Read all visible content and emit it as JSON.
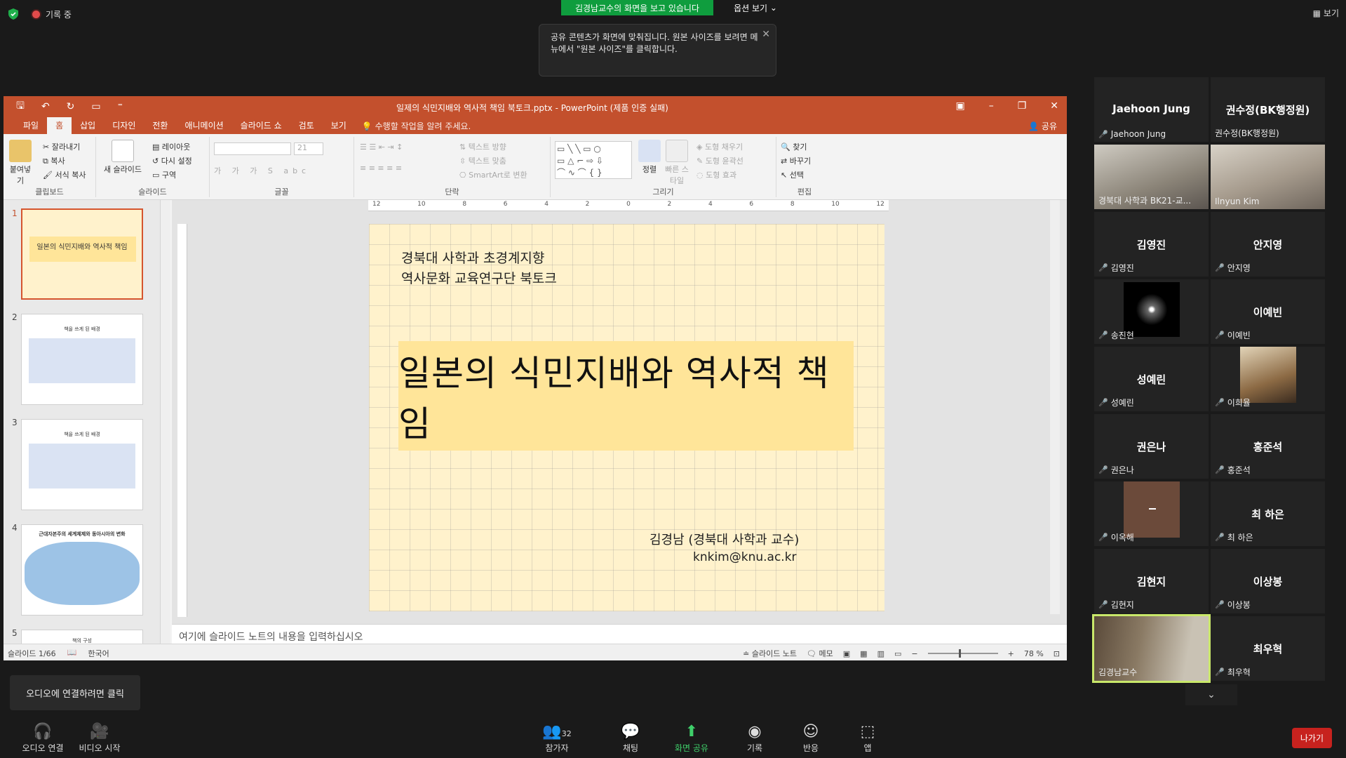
{
  "zoom": {
    "recording": "기록 중",
    "share_banner": "김경남교수의 화면을 보고 있습니다",
    "options": "옵션 보기",
    "view": "보기",
    "tooltip": "공유 콘텐츠가 화면에 맞춰집니다. 원본 사이즈를 보려면 메뉴에서 \"원본 사이즈\"를 클릭합니다.",
    "audio_tip": "오디오에 연결하려면 클릭",
    "toolbar": {
      "audio": "오디오 연결",
      "video": "비디오 시작",
      "participants": "참가자",
      "participants_count": "32",
      "chat": "채팅",
      "share": "화면 공유",
      "record": "기록",
      "reactions": "반응",
      "apps": "앱",
      "leave": "나가기"
    }
  },
  "ppt": {
    "title": "일제의 식민지배와 역사적 책임 북토크.pptx - PowerPoint (제품 인증 실패)",
    "tabs": [
      "파일",
      "홈",
      "삽입",
      "디자인",
      "전환",
      "애니메이션",
      "슬라이드 쇼",
      "검토",
      "보기"
    ],
    "tell_me": "수행할 작업을 알려 주세요.",
    "share": "공유",
    "ribbon": {
      "paste": "붙여넣기",
      "cut": "잘라내기",
      "copy": "복사",
      "format_painter": "서식 복사",
      "clipboard": "클립보드",
      "new_slide": "새 슬라이드",
      "layout": "레이아웃",
      "reset": "다시 설정",
      "section": "구역",
      "slides": "슬라이드",
      "font_size": "21",
      "font": "글꼴",
      "text_direction": "텍스트 방향",
      "align_text": "텍스트 맞춤",
      "smartart": "SmartArt로 변환",
      "paragraph": "단락",
      "arrange": "정렬",
      "quick_styles": "빠른 스타일",
      "shape_fill": "도형 채우기",
      "shape_outline": "도형 윤곽선",
      "shape_effects": "도형 효과",
      "drawing": "그리기",
      "find": "찾기",
      "replace": "바꾸기",
      "select": "선택",
      "editing": "편집"
    },
    "thumbnails": [
      {
        "num": "1",
        "text": "일본의 식민지배와 역사적 책임"
      },
      {
        "num": "2",
        "text": "책을 쓰게 된 배경"
      },
      {
        "num": "3",
        "text": "책을 쓰게 된 배경"
      },
      {
        "num": "4",
        "text": "근대자본주의 세계체제와 동아시아의 변화"
      },
      {
        "num": "5",
        "text": "책의 구성"
      }
    ],
    "slide": {
      "line1": "경북대 사학과 초경계지향",
      "line2": "역사문화 교육연구단 북토크",
      "title": "일본의 식민지배와 역사적 책임",
      "author": "김경남 (경북대 사학과 교수)",
      "email": "knkim@knu.ac.kr"
    },
    "notes_placeholder": "여기에 슬라이드 노트의 내용을 입력하십시오",
    "status": {
      "slide": "슬라이드 1/66",
      "lang": "한국어",
      "notes": "슬라이드 노트",
      "comments": "메모",
      "zoom": "78 %"
    }
  },
  "participants": [
    {
      "name": "Jaehoon Jung",
      "label": "Jaehoon Jung"
    },
    {
      "name": "권수정(BK행정원)",
      "label": "권수정(BK행정원)"
    },
    {
      "name": "경북대 사학과 BK21",
      "label": "경북대 사학과 BK21-교..."
    },
    {
      "name": "Ilnyun Kim",
      "label": "Ilnyun Kim"
    },
    {
      "name": "김영진",
      "label": "김영진"
    },
    {
      "name": "안지영",
      "label": "안지영"
    },
    {
      "name": "송진현",
      "label": "송진현"
    },
    {
      "name": "이예빈",
      "label": "이예빈"
    },
    {
      "name": "성예린",
      "label": "성예린"
    },
    {
      "name": "이희율",
      "label": "이희율"
    },
    {
      "name": "권은나",
      "label": "권은나"
    },
    {
      "name": "홍준석",
      "label": "홍준석"
    },
    {
      "name": "이옥해",
      "label": "이옥해"
    },
    {
      "name": "최 하은",
      "label": "최 하은"
    },
    {
      "name": "김현지",
      "label": "김현지"
    },
    {
      "name": "이상봉",
      "label": "이상봉"
    },
    {
      "name": "김경남교수",
      "label": "김경남교수"
    },
    {
      "name": "최우혁",
      "label": "최우혁"
    }
  ]
}
